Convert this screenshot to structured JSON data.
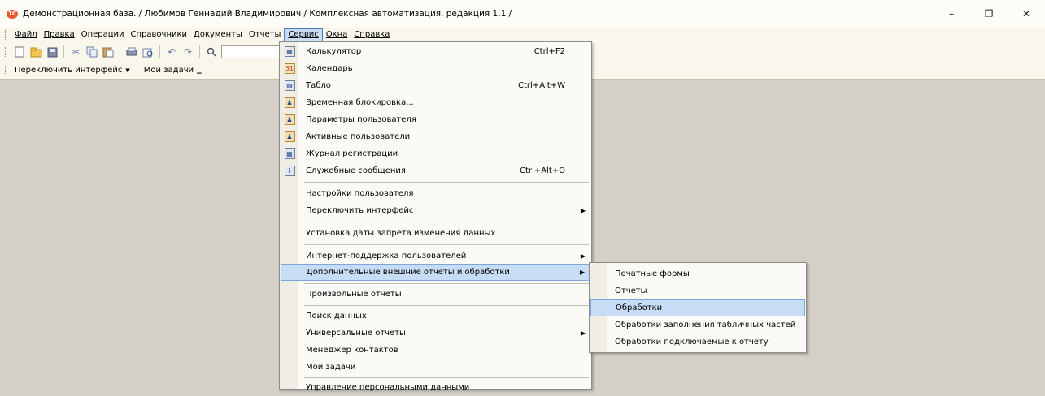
{
  "window": {
    "title": "Демонстрационная база. / Любимов Геннадий Владимирович /  Комплексная автоматизация, редакция 1.1 /",
    "logo_text": "1С",
    "controls": {
      "minimize": "–",
      "restore": "❐",
      "close": "✕"
    }
  },
  "menubar": {
    "items": [
      {
        "label": "Файл"
      },
      {
        "label": "Правка"
      },
      {
        "label": "Операции"
      },
      {
        "label": "Справочники"
      },
      {
        "label": "Документы"
      },
      {
        "label": "Отчеты"
      },
      {
        "label": "Сервис"
      },
      {
        "label": "Окна"
      },
      {
        "label": "Справка"
      }
    ]
  },
  "toolbar2": {
    "switch_interface": "Переключить интерфейс",
    "my_tasks": "Мои задачи"
  },
  "service_menu": {
    "items": [
      {
        "label": "Калькулятор",
        "shortcut": "Ctrl+F2",
        "icon": "calculator-icon"
      },
      {
        "label": "Календарь",
        "shortcut": "",
        "icon": "calendar-icon"
      },
      {
        "label": "Табло",
        "shortcut": "Ctrl+Alt+W",
        "icon": "board-icon"
      },
      {
        "label": "Временная блокировка...",
        "shortcut": "",
        "icon": "lock-user-icon"
      },
      {
        "label": "Параметры пользователя",
        "shortcut": "",
        "icon": "user-settings-icon"
      },
      {
        "label": "Активные пользователи",
        "shortcut": "",
        "icon": "active-users-icon"
      },
      {
        "label": "Журнал регистрации",
        "shortcut": "",
        "icon": "log-icon"
      },
      {
        "label": "Служебные сообщения",
        "shortcut": "Ctrl+Alt+O",
        "icon": "messages-icon"
      },
      {
        "label": "Настройки пользователя",
        "shortcut": ""
      },
      {
        "label": "Переключить интерфейс",
        "shortcut": "",
        "submenu": true
      },
      {
        "label": "Установка даты запрета изменения данных",
        "shortcut": ""
      },
      {
        "label": "Интернет-поддержка пользователей",
        "shortcut": "",
        "submenu": true
      },
      {
        "label": "Дополнительные внешние отчеты и обработки",
        "shortcut": "",
        "submenu": true,
        "highlighted": true
      },
      {
        "label": "Произвольные отчеты",
        "shortcut": ""
      },
      {
        "label": "Поиск данных",
        "shortcut": ""
      },
      {
        "label": "Универсальные отчеты",
        "shortcut": "",
        "submenu": true
      },
      {
        "label": "Менеджер контактов",
        "shortcut": ""
      },
      {
        "label": "Мои задачи",
        "shortcut": ""
      },
      {
        "label": "Управление персональными данными",
        "shortcut": ""
      }
    ]
  },
  "external_submenu": {
    "items": [
      {
        "label": "Печатные формы"
      },
      {
        "label": "Отчеты"
      },
      {
        "label": "Обработки",
        "highlighted": true
      },
      {
        "label": "Обработки заполнения табличных частей"
      },
      {
        "label": "Обработки подключаемые к отчету"
      }
    ]
  },
  "colors": {
    "highlight": "#c7dcf5",
    "highlight_border": "#7ea6d8",
    "workspace": "#d4d0c8",
    "toolbar": "#f9f7ec"
  }
}
